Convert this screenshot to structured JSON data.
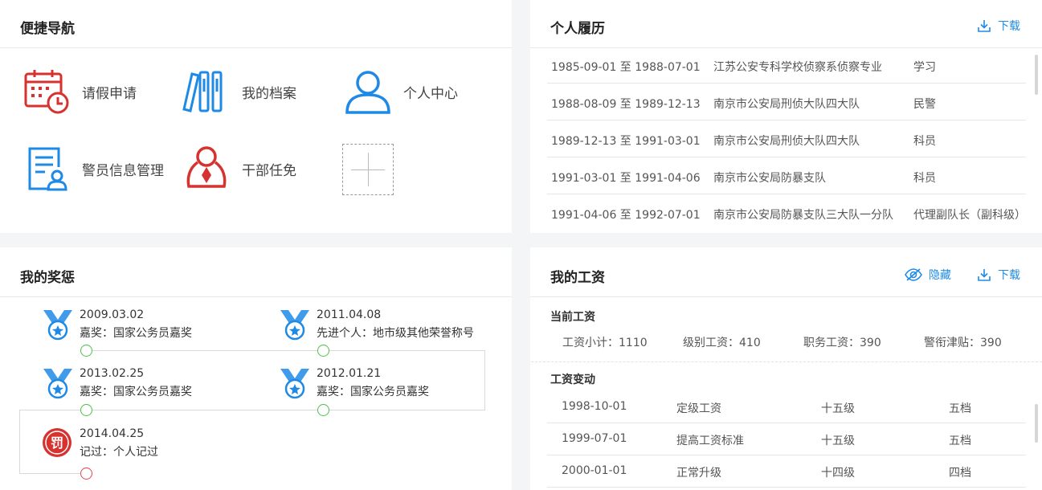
{
  "quick_nav": {
    "title": "便捷导航",
    "items": [
      {
        "label": "请假申请",
        "icon": "calendar-clock-icon"
      },
      {
        "label": "我的档案",
        "icon": "archive-books-icon"
      },
      {
        "label": "个人中心",
        "icon": "user-icon"
      },
      {
        "label": "警员信息管理",
        "icon": "user-document-icon"
      },
      {
        "label": "干部任免",
        "icon": "cadre-tie-icon"
      }
    ],
    "add_icon": "plus-icon"
  },
  "resume": {
    "title": "个人履历",
    "download_label": "下载",
    "rows": [
      {
        "period": "1985-09-01 至 1988-07-01",
        "org": "江苏公安专科学校侦察系侦察专业",
        "position": "学习"
      },
      {
        "period": "1988-08-09 至 1989-12-13",
        "org": "南京市公安局刑侦大队四大队",
        "position": "民警"
      },
      {
        "period": "1989-12-13 至 1991-03-01",
        "org": "南京市公安局刑侦大队四大队",
        "position": "科员"
      },
      {
        "period": "1991-03-01 至 1991-04-06",
        "org": "南京市公安局防暴支队",
        "position": "科员"
      },
      {
        "period": "1991-04-06 至 1992-07-01",
        "org": "南京市公安局防暴支队三大队一分队",
        "position": "代理副队长（副科级）"
      }
    ]
  },
  "awards": {
    "title": "我的奖惩",
    "items": [
      {
        "date": "2009.03.02",
        "desc": "嘉奖：国家公务员嘉奖",
        "kind": "award"
      },
      {
        "date": "2011.04.08",
        "desc": "先进个人：地市级其他荣誉称号",
        "kind": "award"
      },
      {
        "date": "2013.02.25",
        "desc": "嘉奖：国家公务员嘉奖",
        "kind": "award"
      },
      {
        "date": "2012.01.21",
        "desc": "嘉奖：国家公务员嘉奖",
        "kind": "award"
      },
      {
        "date": "2014.04.25",
        "desc": "记过：个人记过",
        "kind": "penalty",
        "badge": "罚"
      }
    ],
    "colors": {
      "award": "#1e8ae6",
      "penalty": "#d6322f",
      "dot_ok": "#4fbf4a",
      "dot_bad": "#e0474c"
    }
  },
  "salary": {
    "title": "我的工资",
    "hide_label": "隐藏",
    "download_label": "下载",
    "current_title": "当前工资",
    "current": [
      {
        "text": "工资小计：1110"
      },
      {
        "text": "级别工资：410"
      },
      {
        "text": "职务工资：390"
      },
      {
        "text": "警衔津贴：390"
      }
    ],
    "changes_title": "工资变动",
    "changes": [
      {
        "date": "1998-10-01",
        "type": "定级工资",
        "level": "十五级",
        "grade": "五档"
      },
      {
        "date": "1999-07-01",
        "type": "提高工资标准",
        "level": "十五级",
        "grade": "五档"
      },
      {
        "date": "2000-01-01",
        "type": "正常升级",
        "level": "十四级",
        "grade": "四档"
      }
    ]
  },
  "accent_color": "#1e8ae6",
  "alert_color": "#d6322f"
}
